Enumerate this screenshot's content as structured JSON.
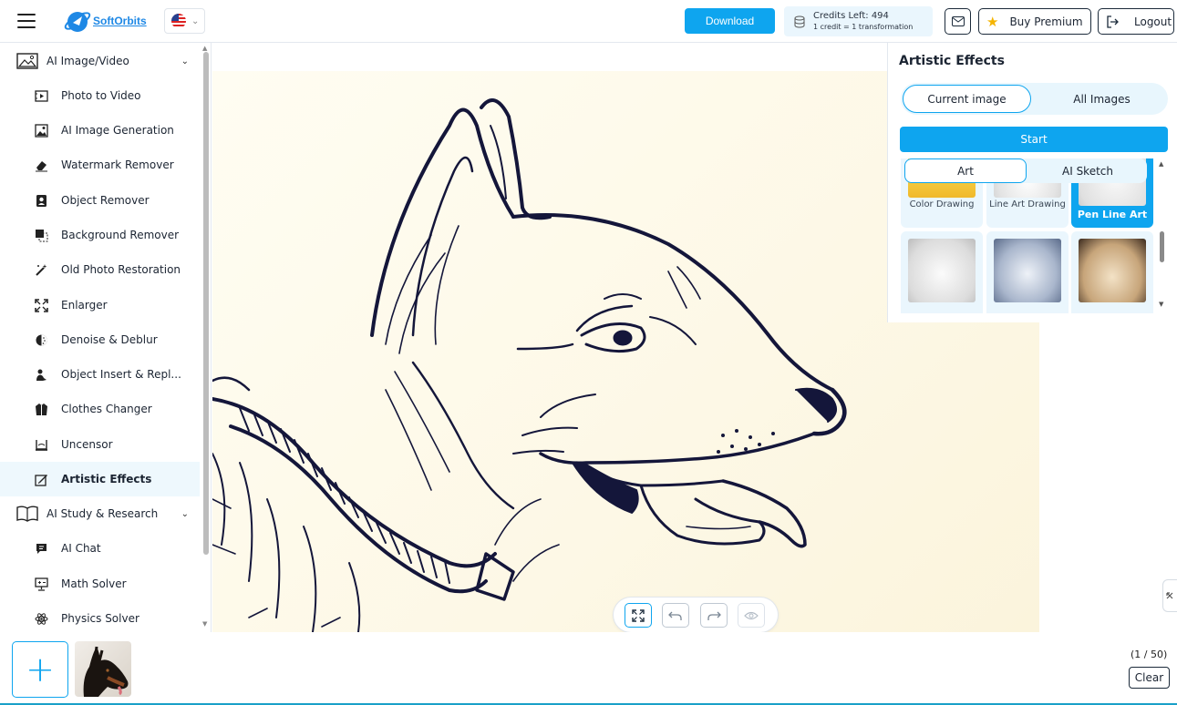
{
  "header": {
    "logo_text": "SoftOrbits",
    "download_label": "Download",
    "credits_line1": "Credits Left:  494",
    "credits_line2": "1 credit = 1 transformation",
    "premium_label": "Buy Premium",
    "logout_label": "Logout"
  },
  "sidebar": {
    "groups": [
      {
        "label": "AI Image/Video",
        "icon": "image-icon"
      },
      {
        "label": "AI Study & Research",
        "icon": "book-icon"
      }
    ],
    "items": [
      {
        "label": "Photo to Video",
        "icon": "video-icon"
      },
      {
        "label": "AI Image Generation",
        "icon": "image-generation-icon"
      },
      {
        "label": "Watermark Remover",
        "icon": "eraser-icon"
      },
      {
        "label": "Object Remover",
        "icon": "object-remover-icon"
      },
      {
        "label": "Background Remover",
        "icon": "background-remover-icon"
      },
      {
        "label": "Old Photo Restoration",
        "icon": "magic-wand-icon"
      },
      {
        "label": "Enlarger",
        "icon": "expand-icon"
      },
      {
        "label": "Denoise & Deblur",
        "icon": "denoise-icon"
      },
      {
        "label": "Object Insert & Repl...",
        "icon": "object-insert-icon"
      },
      {
        "label": "Clothes Changer",
        "icon": "jacket-icon"
      },
      {
        "label": "Uncensor",
        "icon": "uncensor-icon"
      },
      {
        "label": "Artistic Effects",
        "icon": "brush-icon",
        "active": true
      },
      {
        "label": "AI Chat",
        "icon": "chat-icon"
      },
      {
        "label": "Math Solver",
        "icon": "math-icon"
      },
      {
        "label": "Physics Solver",
        "icon": "atom-icon"
      }
    ]
  },
  "panel": {
    "title": "Artistic Effects",
    "scope_current": "Current image",
    "scope_all": "All Images",
    "start_label": "Start",
    "tab_art": "Art",
    "tab_sketch": "AI Sketch",
    "styles": [
      {
        "label": "Color Drawing"
      },
      {
        "label": "Line Art Drawing"
      },
      {
        "label": "Pen Line Art",
        "selected": true
      },
      {
        "label": ""
      },
      {
        "label": ""
      },
      {
        "label": ""
      }
    ]
  },
  "footer": {
    "add_label": "+",
    "counter": "(1 / 50)",
    "clear_label": "Clear"
  },
  "colors": {
    "accent": "#0ea5ef",
    "active_bg": "#eef8fd",
    "canvas_bg": "#fdf8e6"
  }
}
